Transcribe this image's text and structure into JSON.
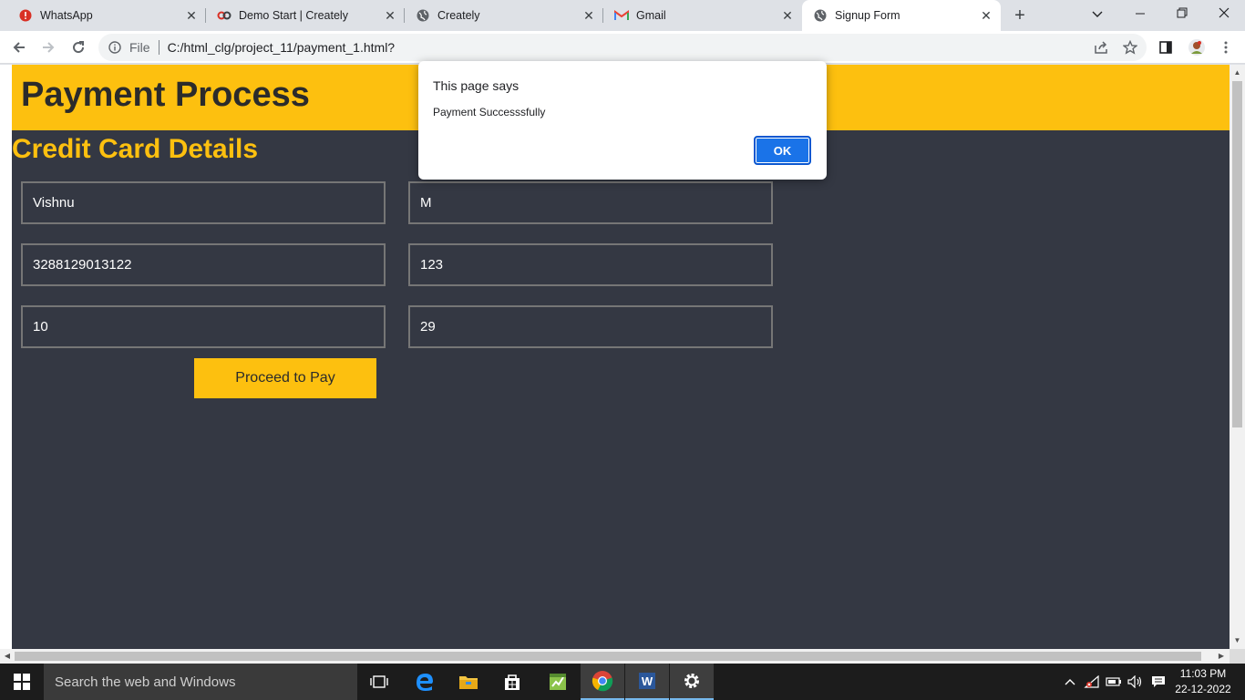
{
  "browser": {
    "tabs": [
      {
        "title": "WhatsApp",
        "icon": "whatsapp-alert-icon"
      },
      {
        "title": "Demo Start | Creately",
        "icon": "creately-icon"
      },
      {
        "title": "Creately",
        "icon": "globe-icon"
      },
      {
        "title": "Gmail",
        "icon": "gmail-icon"
      },
      {
        "title": "Signup Form",
        "icon": "globe-icon",
        "active": true
      }
    ],
    "address": {
      "scheme_label": "File",
      "url": "C:/html_clg/project_11/payment_1.html?"
    }
  },
  "page": {
    "header_title": "Payment Process",
    "section_title": "Credit Card Details",
    "fields": {
      "first_name": "Vishnu",
      "last_name": "M",
      "card_number": "3288129013122",
      "cvv": "123",
      "exp_month": "10",
      "exp_year": "29"
    },
    "pay_button": "Proceed to Pay",
    "colors": {
      "accent": "#fdc00f",
      "background": "#343843"
    }
  },
  "dialog": {
    "title": "This page says",
    "message": "Payment Successsfully",
    "ok_label": "OK"
  },
  "taskbar": {
    "search_placeholder": "Search the web and Windows",
    "time": "11:03 PM",
    "date": "22-12-2022"
  }
}
